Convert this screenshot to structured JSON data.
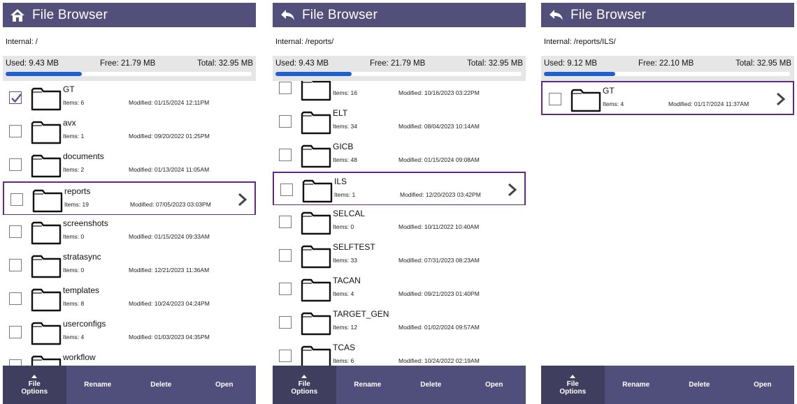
{
  "app": {
    "title": "File Browser"
  },
  "colors": {
    "titlebar": "#52507a",
    "bottombar": "#504e7a",
    "selection": "#5e2a82",
    "usage_bar": "#1e5fd6"
  },
  "panels": [
    {
      "title_icon": "home-icon",
      "path": "Internal: /",
      "used": "Used: 9.43 MB",
      "free": "Free: 21.79 MB",
      "total": "Total: 32.95 MB",
      "usage_fraction": 0.31,
      "rows": [
        {
          "name": "GT",
          "items": "Items: 6",
          "modified": "Modified: 01/15/2024 12:11PM",
          "checked": true,
          "selected": false
        },
        {
          "name": "avx",
          "items": "Items: 1",
          "modified": "Modified: 09/20/2022 01:25PM",
          "checked": false,
          "selected": false
        },
        {
          "name": "documents",
          "items": "Items: 2",
          "modified": "Modified: 01/13/2024 11:05AM",
          "checked": false,
          "selected": false
        },
        {
          "name": "reports",
          "items": "Items: 19",
          "modified": "Modified: 07/05/2023 03:03PM",
          "checked": false,
          "selected": true
        },
        {
          "name": "screenshots",
          "items": "Items: 0",
          "modified": "Modified: 01/15/2024 09:33AM",
          "checked": false,
          "selected": false
        },
        {
          "name": "stratasync",
          "items": "Items: 0",
          "modified": "Modified: 12/21/2023 11:36AM",
          "checked": false,
          "selected": false
        },
        {
          "name": "templates",
          "items": "Items: 8",
          "modified": "Modified: 10/24/2023 04:24PM",
          "checked": false,
          "selected": false
        },
        {
          "name": "userconfigs",
          "items": "Items: 4",
          "modified": "Modified: 01/03/2023 04:35PM",
          "checked": false,
          "selected": false
        },
        {
          "name": "workflow",
          "items": "",
          "modified": "",
          "checked": false,
          "selected": false
        }
      ]
    },
    {
      "title_icon": "back-arrow-icon",
      "path": "Internal: /reports/",
      "used": "Used: 9.43 MB",
      "free": "Free: 21.79 MB",
      "total": "Total: 32.95 MB",
      "usage_fraction": 0.31,
      "rows": [
        {
          "name": "",
          "items": "Items: 16",
          "modified": "Modified: 10/16/2023 03:22PM",
          "checked": false,
          "selected": false
        },
        {
          "name": "ELT",
          "items": "Items: 34",
          "modified": "Modified: 08/04/2023 10:14AM",
          "checked": false,
          "selected": false
        },
        {
          "name": "GICB",
          "items": "Items: 48",
          "modified": "Modified: 01/15/2024 09:08AM",
          "checked": false,
          "selected": false
        },
        {
          "name": "ILS",
          "items": "Items: 1",
          "modified": "Modified: 12/20/2023 03:42PM",
          "checked": false,
          "selected": true
        },
        {
          "name": "SELCAL",
          "items": "Items: 0",
          "modified": "Modified: 10/11/2022 10:40AM",
          "checked": false,
          "selected": false
        },
        {
          "name": "SELFTEST",
          "items": "Items: 33",
          "modified": "Modified: 07/31/2023 08:23AM",
          "checked": false,
          "selected": false
        },
        {
          "name": "TACAN",
          "items": "Items: 4",
          "modified": "Modified: 09/21/2023 01:40PM",
          "checked": false,
          "selected": false
        },
        {
          "name": "TARGET_GEN",
          "items": "Items: 12",
          "modified": "Modified: 01/02/2024 09:57AM",
          "checked": false,
          "selected": false
        },
        {
          "name": "TCAS",
          "items": "Items: 6",
          "modified": "Modified: 10/24/2022 02:19AM",
          "checked": false,
          "selected": false
        },
        {
          "name": "",
          "items": "",
          "modified": "",
          "checked": false,
          "selected": false
        }
      ]
    },
    {
      "title_icon": "back-arrow-icon",
      "path": "Internal: /reports/ILS/",
      "used": "Used: 9.12 MB",
      "free": "Free: 22.10 MB",
      "total": "Total: 32.95 MB",
      "usage_fraction": 0.29,
      "rows": [
        {
          "name": "GT",
          "items": "Items: 4",
          "modified": "Modified: 01/17/2024 11:37AM",
          "checked": false,
          "selected": true
        }
      ]
    }
  ],
  "buttons": {
    "file_options_line1": "File",
    "file_options_line2": "Options",
    "rename": "Rename",
    "delete": "Delete",
    "open": "Open"
  }
}
